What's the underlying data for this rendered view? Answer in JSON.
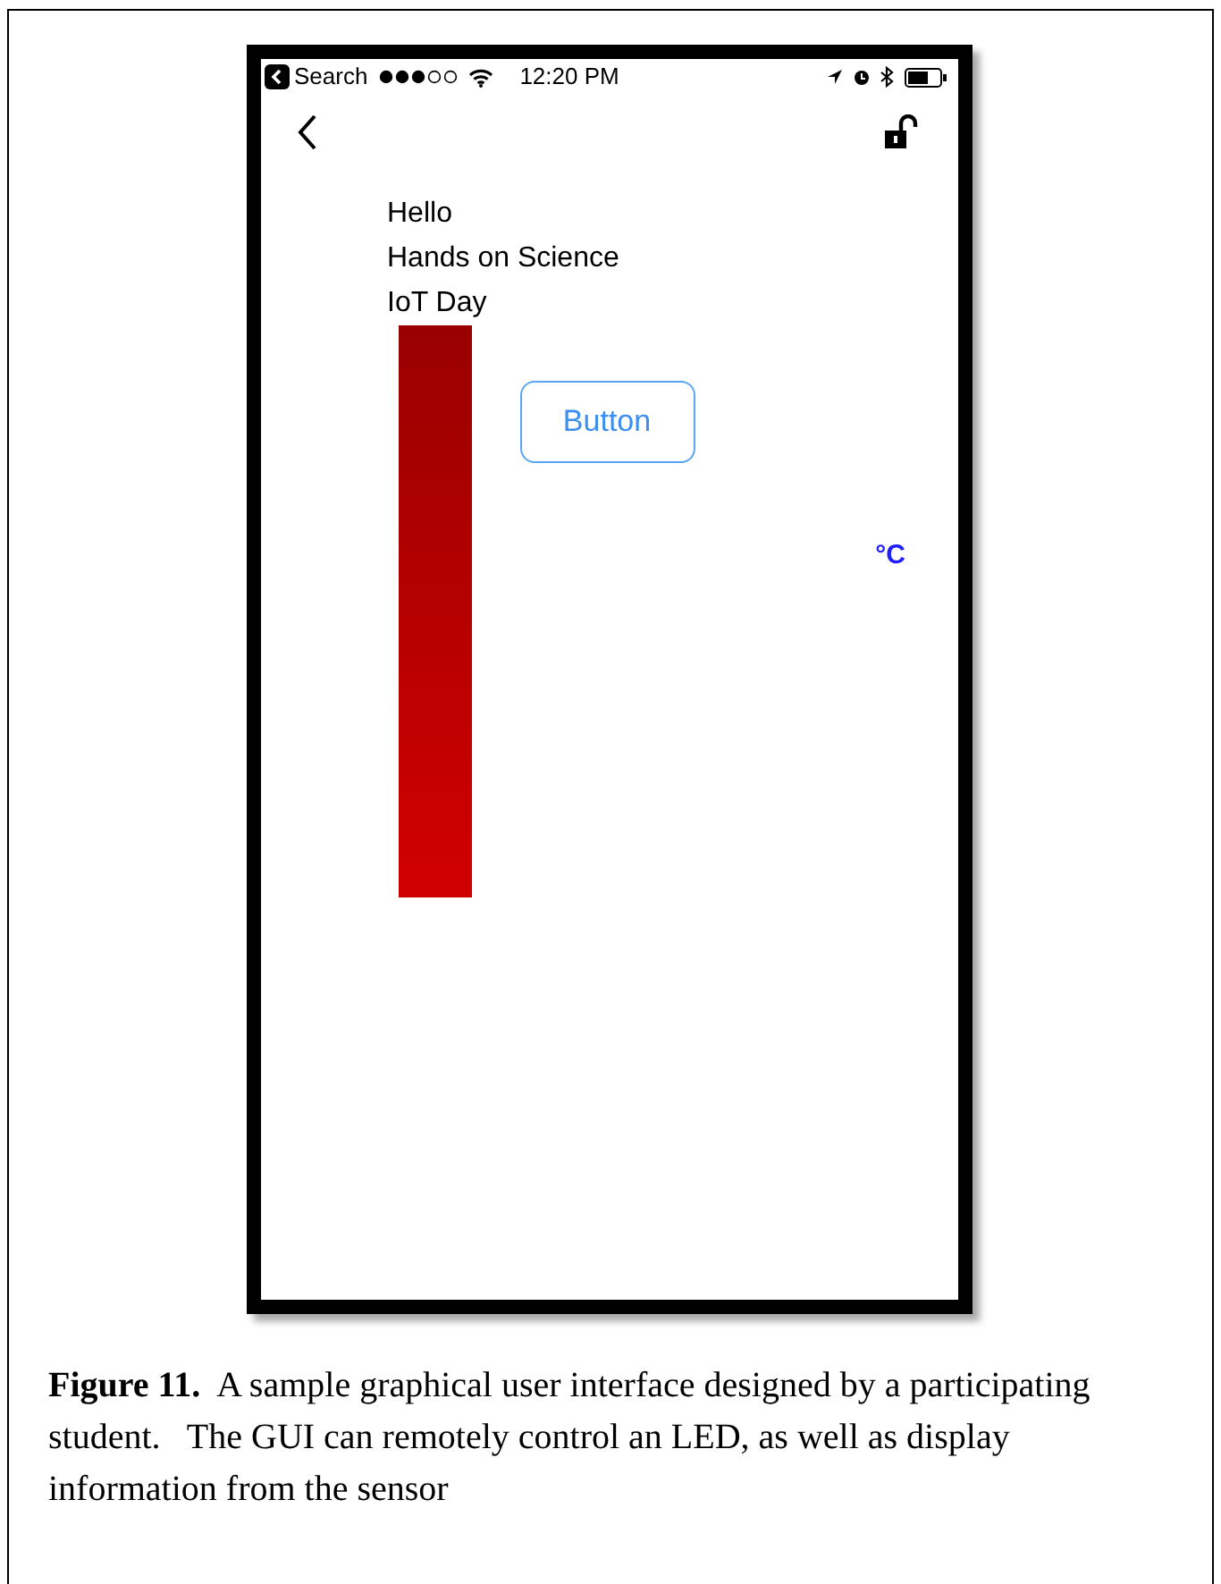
{
  "phone": {
    "status_bar": {
      "back_label": "Search",
      "time": "12:20 PM"
    },
    "content": {
      "lines": [
        "Hello",
        "Hands on Science",
        "IoT Day"
      ],
      "button": "Button",
      "temperature_unit": "°C"
    }
  },
  "caption": "**Figure 11.**  A sample graphical user interface designed by a participating student.   The GUI can remotely control an LED, as well as display information from the sensor"
}
